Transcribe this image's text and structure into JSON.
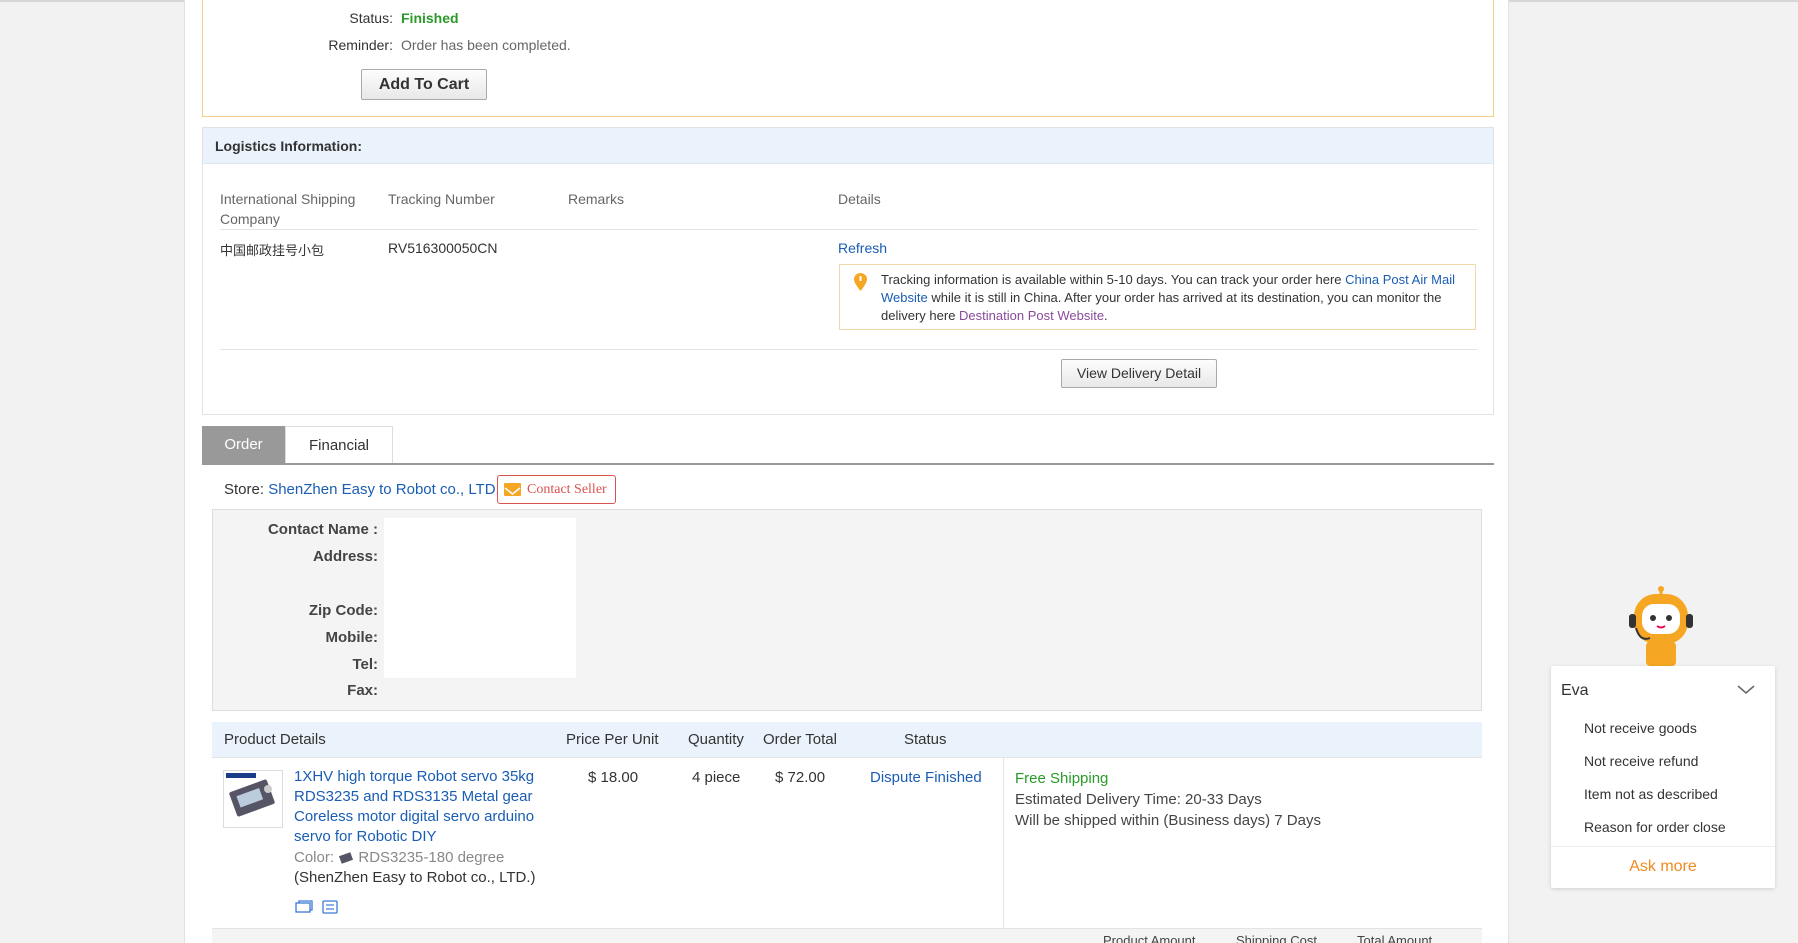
{
  "status": {
    "status_label": "Status:",
    "status_value": "Finished",
    "reminder_label": "Reminder:",
    "reminder_value": "Order has been completed.",
    "add_to_cart": "Add To Cart"
  },
  "logistics": {
    "title": "Logistics Information:",
    "columns": [
      "International Shipping Company",
      "Tracking Number",
      "Remarks",
      "Details"
    ],
    "company": "中国邮政挂号小包",
    "tracking_number": "RV516300050CN",
    "refresh": "Refresh",
    "tip_text_1": "Tracking information is available within 5-10 days. You can track your order here ",
    "tip_link_1": "China Post Air Mail Website",
    "tip_text_2": " while it is still in China. After your order has arrived at its destination, you can monitor the delivery here ",
    "tip_link_2": "Destination Post Website",
    "tip_text_3": ".",
    "view_delivery": "View Delivery Detail"
  },
  "tabs": [
    "Order",
    "Financial"
  ],
  "store": {
    "label": "Store:",
    "name": "ShenZhen Easy to Robot co., LTD.",
    "contact_seller": "Contact Seller"
  },
  "address": {
    "contact_name": "Contact Name :",
    "address": "Address:",
    "zip": "Zip Code:",
    "mobile": "Mobile:",
    "tel": "Tel:",
    "fax": "Fax:"
  },
  "products": {
    "headers": [
      "Product Details",
      "Price Per Unit",
      "Quantity",
      "Order Total",
      "Status"
    ],
    "item": {
      "title_lines": [
        "1XHV high torque Robot servo 35kg",
        "RDS3235 and RDS3135 Metal gear",
        "Coreless motor digital servo arduino",
        "servo for Robotic DIY"
      ],
      "color_label": "Color:",
      "color_value": "RDS3235-180 degree",
      "seller": "(ShenZhen Easy to Robot co., LTD.)",
      "price": "$ 18.00",
      "quantity": "4 piece",
      "total": "$ 72.00",
      "status": "Dispute Finished",
      "shipping": "Free Shipping",
      "delivery_time": "Estimated Delivery Time:  20-33 Days",
      "ship_within": "Will be shipped within (Business days) 7 Days"
    },
    "totals_headers": [
      "Product Amount",
      "Shipping Cost",
      "Total Amount"
    ]
  },
  "eva": {
    "name": "Eva",
    "items": [
      "Not receive goods",
      "Not receive refund",
      "Item not as described",
      "Reason for order close"
    ],
    "ask_more": "Ask more"
  },
  "colors": {
    "accent_blue": "#1a5db4",
    "finished_green": "#2a9a2a",
    "contact_red": "#d9534f",
    "eva_orange": "#f08a1e"
  }
}
